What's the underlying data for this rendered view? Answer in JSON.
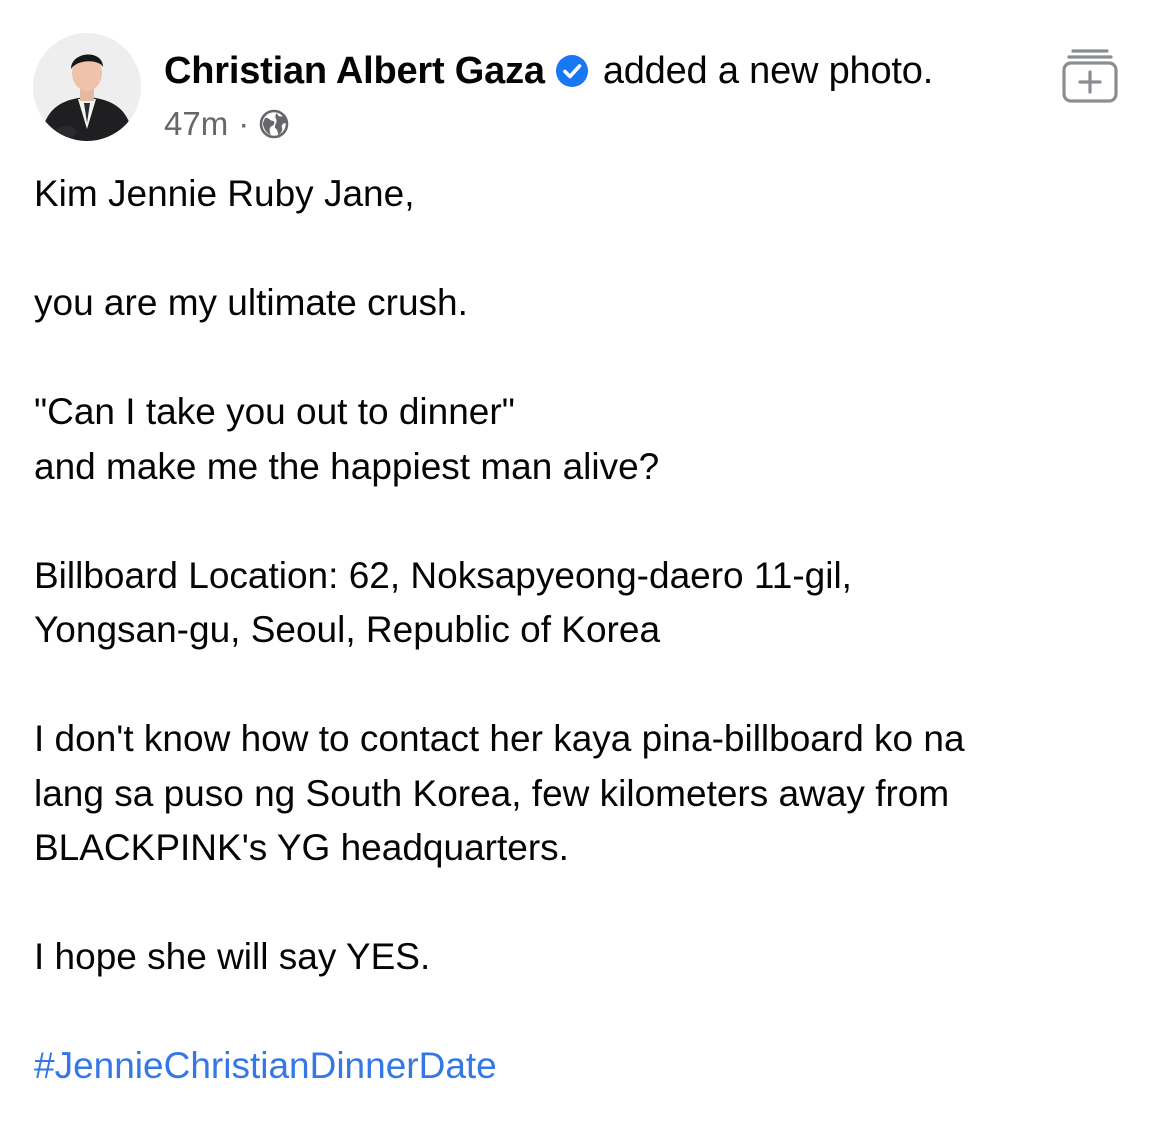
{
  "post": {
    "author": "Christian Albert Gaza",
    "verified": true,
    "action": "added a new photo.",
    "timestamp": "47m",
    "separator": "·",
    "privacy_icon": "globe-icon",
    "save_icon": "add-to-collection-icon",
    "body": {
      "p1": "Kim Jennie Ruby Jane,",
      "p2": "you are my ultimate crush.",
      "p3_line1": "\"Can I take you out to dinner\"",
      "p3_line2": "and make me the happiest man alive?",
      "p4_line1": "Billboard Location: 62, Noksapyeong-daero 11-gil,",
      "p4_line2": "Yongsan-gu, Seoul, Republic of Korea",
      "p5_line1": "I don't know how to contact her kaya pina-billboard ko na",
      "p5_line2": "lang sa puso ng South Korea, few kilometers away from",
      "p5_line3": "BLACKPINK's YG headquarters.",
      "p6": "I hope she will say YES.",
      "hashtag": "#JennieChristianDinnerDate"
    }
  },
  "colors": {
    "text": "#050505",
    "secondary": "#65676b",
    "link": "#3578e5",
    "verified_badge": "#1877f2"
  }
}
